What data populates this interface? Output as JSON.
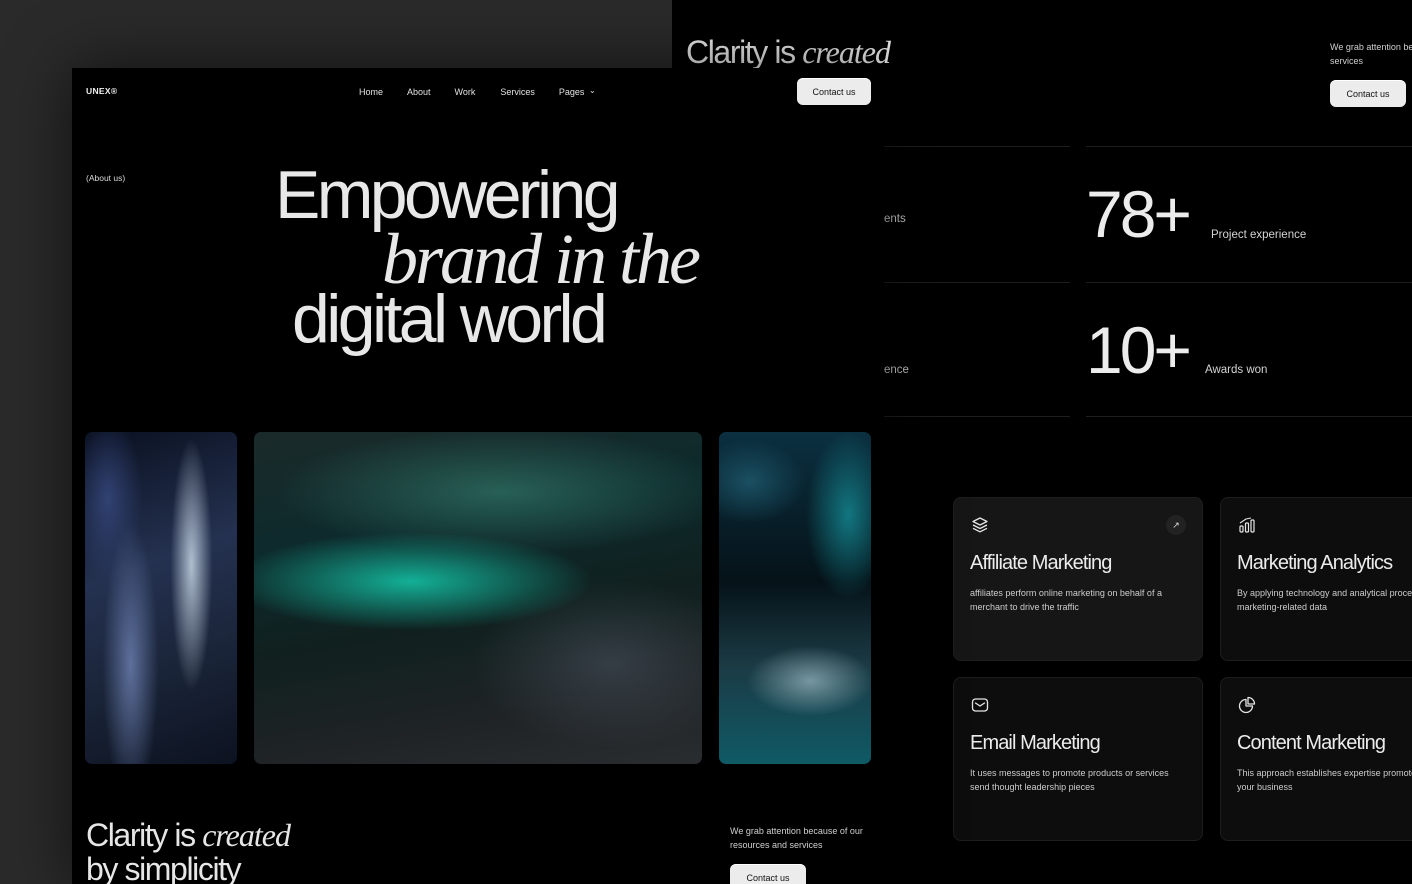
{
  "back": {
    "clarity_plain": "Clarity is",
    "clarity_italic": "created",
    "tagline": "We grab attention because of our resources and services",
    "contact_label": "Contact us",
    "stats": [
      {
        "number": "78+",
        "label": "Project experience"
      },
      {
        "number": "10+",
        "label": "Awards won"
      }
    ],
    "stat_fragments": [
      "ents",
      "ence"
    ],
    "services": [
      {
        "icon": "layers-icon",
        "title": "Affiliate Marketing",
        "desc": "affiliates perform online marketing on behalf of a merchant to drive the traffic",
        "arrow": "↗"
      },
      {
        "icon": "bar-chart-icon",
        "title": "Marketing Analytics",
        "desc": "By applying technology and analytical processes to marketing-related data"
      },
      {
        "icon": "mail-icon",
        "title": "Email Marketing",
        "desc": "It uses messages to promote products or services send thought leadership pieces"
      },
      {
        "icon": "pie-chart-icon",
        "title": "Content Marketing",
        "desc": "This approach establishes expertise promotes and keeps your business"
      }
    ]
  },
  "front": {
    "logo": "UNEX®",
    "nav": {
      "home": "Home",
      "about": "About",
      "work": "Work",
      "services": "Services",
      "pages": "Pages",
      "pages_chevron": "⌄"
    },
    "contact_label": "Contact us",
    "about_tag": "(About us)",
    "hero": {
      "line1": "Empowering",
      "line2": "brand in the",
      "line3": "digital world"
    },
    "clarity_plain": "Clarity is",
    "clarity_italic": "created",
    "clarity_line2": "by simplicity",
    "tagline": "We grab attention because of our resources and services",
    "contact_label2": "Contact us"
  }
}
